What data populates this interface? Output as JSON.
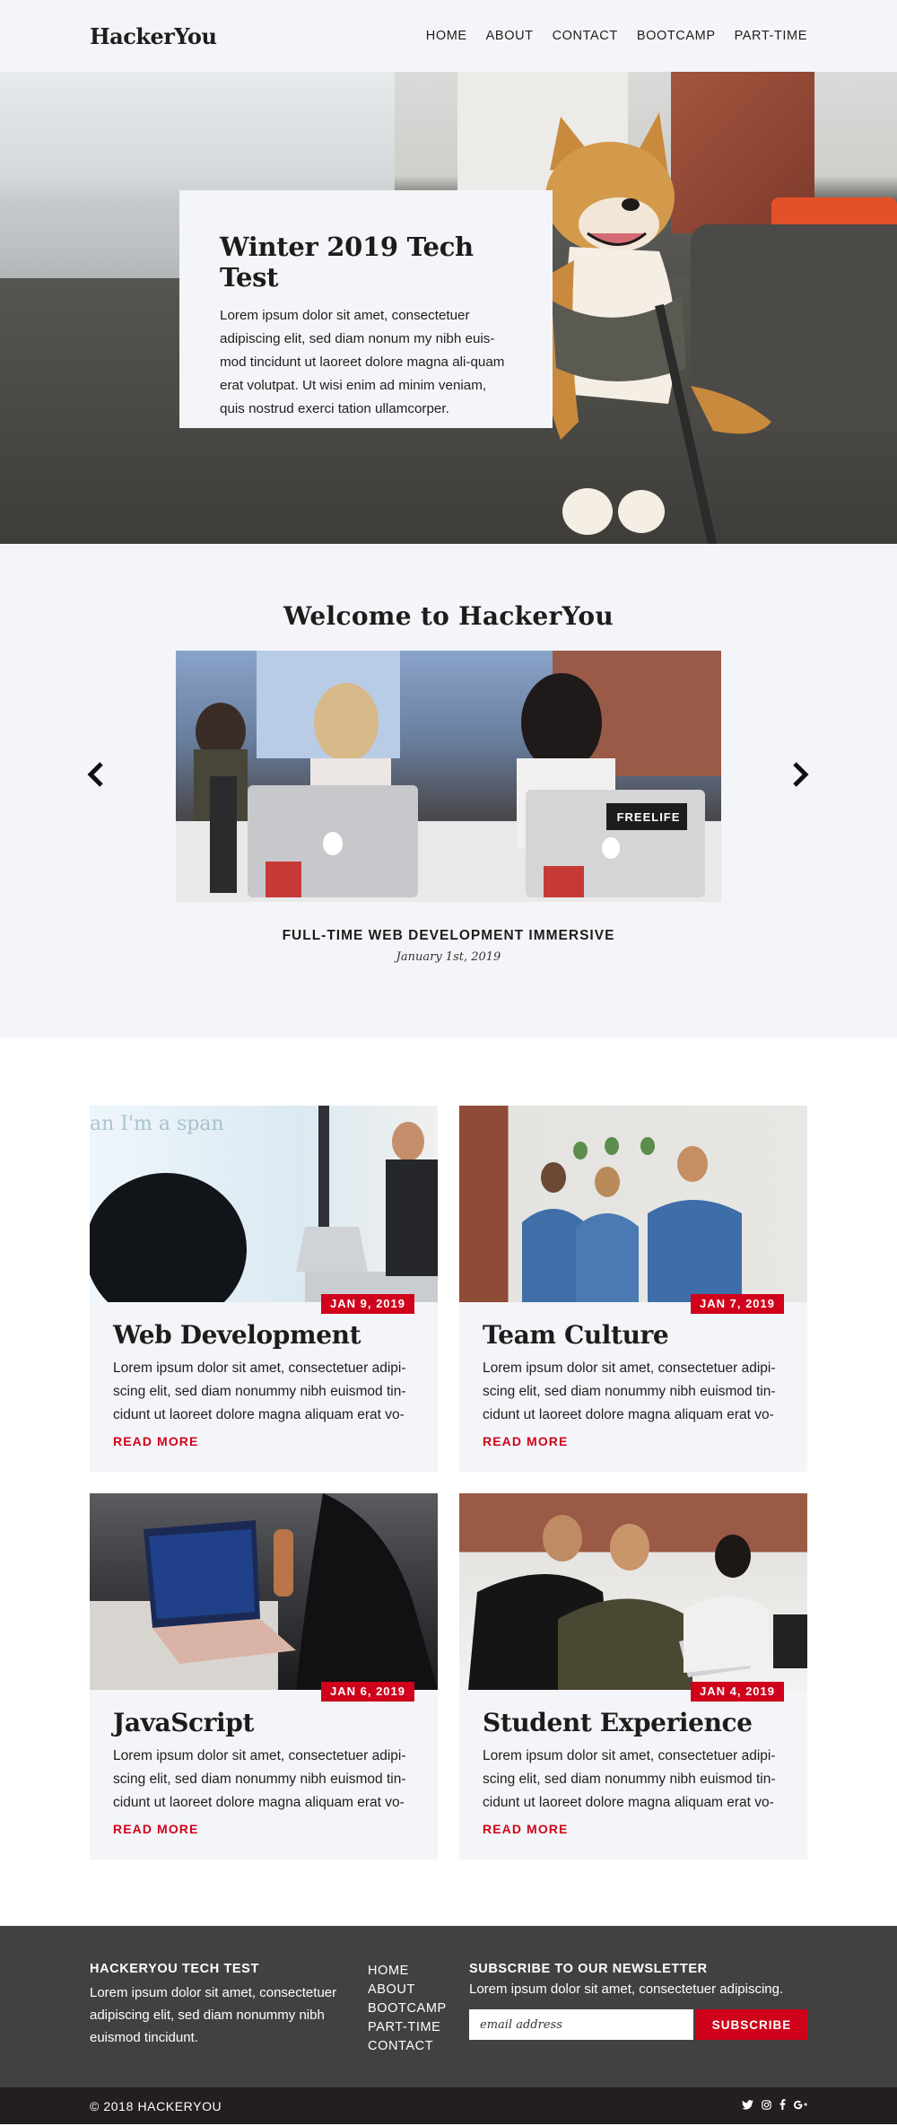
{
  "header": {
    "logo": "HackerYou",
    "nav": [
      "HOME",
      "ABOUT",
      "CONTACT",
      "BOOTCAMP",
      "PART-TIME"
    ]
  },
  "hero": {
    "title": "Winter 2019 Tech Test",
    "text": "Lorem ipsum dolor sit amet, consectetuer adipiscing elit, sed diam nonum my nibh euis-mod tincidunt ut laoreet dolore magna ali-quam erat volutpat. Ut wisi enim ad minim veniam, quis nostrud exerci tation ullamcorper.",
    "image": "shiba-dog-on-sofa"
  },
  "carousel": {
    "heading": "Welcome to HackerYou",
    "slide_title": "FULL-TIME WEB DEVELOPMENT IMMERSIVE",
    "slide_date": "January 1st, 2019",
    "sticker": "FREELIFE",
    "prev_icon": "chevron-left-icon",
    "next_icon": "chevron-right-icon"
  },
  "posts": [
    {
      "title": "Web Development",
      "date": "JAN 9, 2019",
      "overlay": "an I'm a span",
      "text": "Lorem ipsum dolor sit amet, consectetuer adipi-scing elit, sed diam nonummy nibh euismod tin-cidunt ut laoreet dolore magna aliquam erat vo-",
      "link": "READ MORE"
    },
    {
      "title": "Team Culture",
      "date": "JAN 7, 2019",
      "text": "Lorem ipsum dolor sit amet, consectetuer adipi-scing elit, sed diam nonummy nibh euismod tin-cidunt ut laoreet dolore magna aliquam erat vo-",
      "link": "READ MORE"
    },
    {
      "title": "JavaScript",
      "date": "JAN 6, 2019",
      "text": "Lorem ipsum dolor sit amet, consectetuer adipi-scing elit, sed diam nonummy nibh euismod tin-cidunt ut laoreet dolore magna aliquam erat vo-",
      "link": "READ MORE"
    },
    {
      "title": "Student Experience",
      "date": "JAN 4, 2019",
      "text": "Lorem ipsum dolor sit amet, consectetuer adipi-scing elit, sed diam nonummy nibh euismod tin-cidunt ut laoreet dolore magna aliquam erat vo-",
      "link": "READ MORE"
    }
  ],
  "footer": {
    "about_heading": "HACKERYOU TECH TEST",
    "about_text": "Lorem ipsum dolor sit amet, consectetuer adipiscing elit, sed diam nonummy nibh euismod tincidunt.",
    "links": [
      "HOME",
      "ABOUT",
      "BOOTCAMP",
      "PART-TIME",
      "CONTACT"
    ],
    "newsletter_heading": "SUBSCRIBE TO OUR NEWSLETTER",
    "newsletter_text": "Lorem ipsum dolor sit amet, consectetuer adipiscing.",
    "email_placeholder": "email address",
    "subscribe_label": "SUBSCRIBE",
    "copyright": "© 2018 HACKERYOU",
    "socials": [
      "twitter-icon",
      "instagram-icon",
      "facebook-icon",
      "google-plus-icon"
    ]
  },
  "colors": {
    "accent": "#d0021b",
    "light_bg": "#f4f5f8",
    "footer_bg": "#414141",
    "bottom_bar_bg": "#231f1f"
  }
}
